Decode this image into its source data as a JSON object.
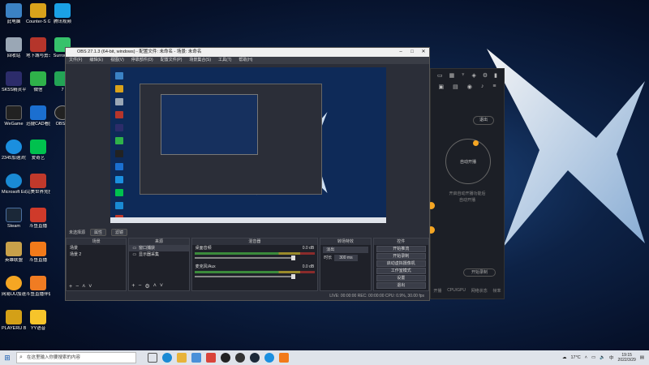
{
  "colors": {
    "accent_orange": "#f5a623",
    "taskbar": "#dfe3ea",
    "obs_bg": "#2b2e38"
  },
  "desktop_icons": [
    {
      "label": "此电脑",
      "color": "#3b82c4",
      "icon": "computer-icon"
    },
    {
      "label": "Counter-S Global Off...",
      "color": "#d9a21b",
      "icon": "csgo-icon"
    },
    {
      "label": "腾讯视频",
      "color": "#1aa1e6",
      "icon": "tencent-video-icon"
    },
    {
      "label": "回收站",
      "color": "#9aa7b5",
      "icon": "recycle-bin-icon"
    },
    {
      "label": "地下城与勇士",
      "color": "#b5352b",
      "icon": "dnf-icon"
    },
    {
      "label": "Surround",
      "color": "#36c26b",
      "icon": "surround-icon"
    },
    {
      "label": "SK5S精灵平台",
      "color": "#2c2c6a",
      "icon": "sk5s-icon"
    },
    {
      "label": "微信",
      "color": "#2fb24a",
      "icon": "wechat-icon"
    },
    {
      "label": "7",
      "color": "#23a455",
      "icon": "app-7-icon"
    },
    {
      "label": "WeGame",
      "color": "#222",
      "icon": "wegame-icon"
    },
    {
      "label": "迅捷CAD看图",
      "color": "#1b6fd0",
      "icon": "cad-icon"
    },
    {
      "label": "OBS S",
      "color": "#222",
      "icon": "obs-icon"
    },
    {
      "label": "2345加速浏览器",
      "color": "#1b8fdf",
      "icon": "browser-2345-icon"
    },
    {
      "label": "爱奇艺",
      "color": "#00c14e",
      "icon": "iqiyi-icon"
    },
    {
      "label": "Microsoft Edge",
      "color": "#1a8ad4",
      "icon": "edge-icon"
    },
    {
      "label": "完美世界竞技平台",
      "color": "#c0392b",
      "icon": "perfect-world-icon"
    },
    {
      "label": "Steam",
      "color": "#1b2838",
      "icon": "steam-icon"
    },
    {
      "label": "斗鱼直播",
      "color": "#cf3a2a",
      "icon": "douyu-icon"
    },
    {
      "label": "英雄联盟",
      "color": "#c8a14a",
      "icon": "lol-icon"
    },
    {
      "label": "斗鱼直播",
      "color": "#f27a1a",
      "icon": "douyu-live-icon"
    },
    {
      "label": "网易UU加速器",
      "color": "#f5a623",
      "icon": "uu-icon"
    },
    {
      "label": "斗鱼直播伴侣",
      "color": "#f07c22",
      "icon": "douyu-companion-icon"
    },
    {
      "label": "PLAYERU BATTLEGR...",
      "color": "#d4a017",
      "icon": "pubg-icon"
    },
    {
      "label": "YY语音",
      "color": "#f6c42b",
      "icon": "yy-icon"
    }
  ],
  "obs": {
    "title": "OBS 27.1.3 (64-bit, windows) - 配置文件: 未命名 - 场景: 未命名",
    "menu": [
      "文件(F)",
      "编辑(E)",
      "视图(V)",
      "停靠部件(D)",
      "配置文件(P)",
      "场景集合(S)",
      "工具(T)",
      "帮助(H)"
    ],
    "toolbar": {
      "label": "未选择源",
      "props": "属性",
      "filters": "滤镜"
    },
    "docks": {
      "scenes_title": "场景",
      "scenes": [
        "场景",
        "场景 2"
      ],
      "sources_title": "来源",
      "sources": [
        "窗口捕获",
        "显示器采集"
      ],
      "mixer_title": "混音器",
      "mixer": [
        {
          "name": "桌面音频",
          "db": "0.0 dB"
        },
        {
          "name": "麦克风/Aux",
          "db": "0.0 dB"
        }
      ],
      "transition_title": "转场特效",
      "transition": {
        "type": "淡出",
        "duration_label": "时长",
        "duration": "300 ms"
      },
      "controls_title": "控件",
      "controls": [
        "开始推流",
        "开始录制",
        "启动虚拟摄像机",
        "工作室模式",
        "设置",
        "退出"
      ]
    },
    "status": "LIVE: 00:00:00   REC: 00:00:00   CPU: 0.9%, 30.00 fps"
  },
  "side_panel": {
    "exit_button": "退出",
    "center_button": "自动开播",
    "desc_line1": "开启自动开播功能后",
    "desc_line2": "自动开播",
    "bottom_button": "开始录制",
    "tabs": [
      "开播",
      "CPU/GPU",
      "网络状态",
      "帧率",
      "推流码"
    ]
  },
  "taskbar": {
    "search_placeholder": "在这里输入你要搜索的内容",
    "weather": "17°C",
    "ime": "中",
    "time": "19:15",
    "date": "2022/3/29"
  }
}
